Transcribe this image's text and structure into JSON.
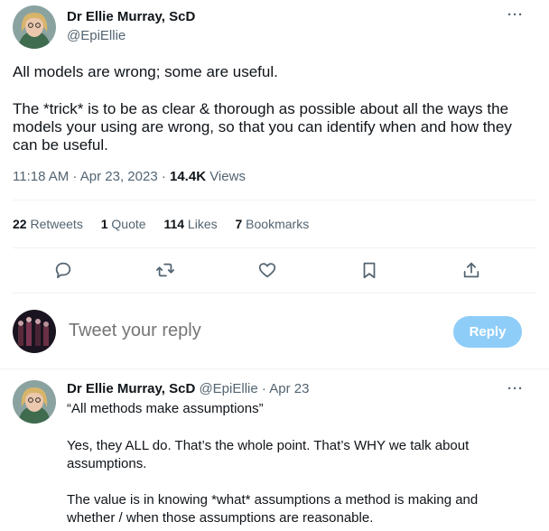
{
  "main_tweet": {
    "author_name": "Dr Ellie Murray, ScD",
    "author_handle": "@EpiEllie",
    "more_label": "···",
    "text_p1": "All models are wrong; some are useful.",
    "text_p2": "The *trick* is to be as clear & thorough as possible about all the ways the models your using are wrong, so that you can identify when and how they can be useful.",
    "time": "11:18 AM · Apr 23, 2023 · ",
    "views_count": "14.4K",
    "views_label": " Views",
    "stats": {
      "retweets_count": "22",
      "retweets_label": " Retweets",
      "quotes_count": "1",
      "quotes_label": " Quote",
      "likes_count": "114",
      "likes_label": " Likes",
      "bookmarks_count": "7",
      "bookmarks_label": " Bookmarks"
    },
    "actions": [
      "reply-icon",
      "retweet-icon",
      "like-icon",
      "bookmark-icon",
      "share-icon"
    ]
  },
  "reply_box": {
    "placeholder": "Tweet your reply",
    "button_label": "Reply"
  },
  "reply_tweet": {
    "author_name": "Dr Ellie Murray, ScD",
    "author_handle": "@EpiEllie",
    "date": " · Apr 23",
    "more_label": "···",
    "text_p1": "“All methods make assumptions”",
    "text_p2": "Yes, they ALL do. That’s the whole point. That’s WHY we talk about assumptions.",
    "text_p3": "The value is in knowing *what* assumptions a method is making and whether / when those assumptions are reasonable."
  },
  "colors": {
    "text": "#0f1419",
    "secondary": "#536471",
    "divider": "#eff3f4",
    "reply_button": "#8ecdf8"
  }
}
